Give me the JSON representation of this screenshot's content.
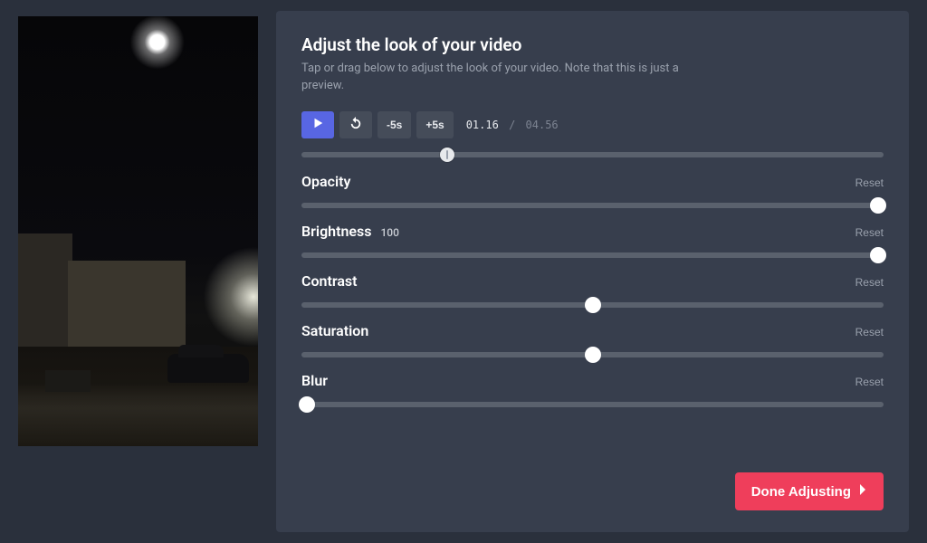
{
  "header": {
    "title": "Adjust the look of your video",
    "subtitle": "Tap or drag below to adjust the look of your video. Note that this is just a preview."
  },
  "transport": {
    "play_icon": "play-icon",
    "restart_icon": "restart-icon",
    "back_label": "-5s",
    "fwd_label": "+5s",
    "current_time": "01.16",
    "separator": "/",
    "duration": "04.56",
    "progress_pct": 25
  },
  "controls": {
    "opacity": {
      "label": "Opacity",
      "value": null,
      "reset": "Reset",
      "pct": 99
    },
    "brightness": {
      "label": "Brightness",
      "value": "100",
      "reset": "Reset",
      "pct": 99
    },
    "contrast": {
      "label": "Contrast",
      "value": null,
      "reset": "Reset",
      "pct": 50
    },
    "saturation": {
      "label": "Saturation",
      "value": null,
      "reset": "Reset",
      "pct": 50
    },
    "blur": {
      "label": "Blur",
      "value": null,
      "reset": "Reset",
      "pct": 1
    }
  },
  "footer": {
    "done_label": "Done Adjusting"
  }
}
